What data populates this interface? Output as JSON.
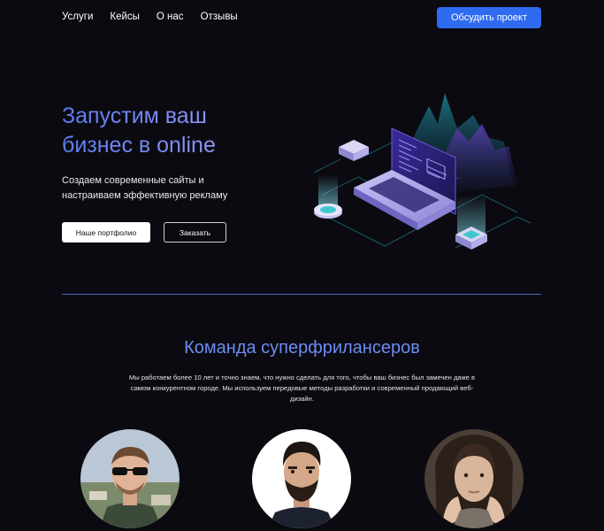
{
  "nav": {
    "links": [
      "Услуги",
      "Кейсы",
      "О нас",
      "Отзывы"
    ],
    "cta": "Обсудить проект"
  },
  "hero": {
    "title_line1": "Запустим ваш",
    "title_line2": "бизнес в online",
    "subtitle": "Создаем современные сайты и настраиваем эффективную рекламу",
    "btn_portfolio": "Наше портфолио",
    "btn_order": "Заказать"
  },
  "team": {
    "title": "Команда суперфрилансеров",
    "description": "Мы работаем более 10 лет и точно знаем, что нужно сделать для того, чтобы ваш бизнес был замечен даже в самом конкурентном городе. Мы используем передовые методы разработки и современный продающий веб-дизайн."
  },
  "colors": {
    "accent": "#2f6bf0",
    "background": "#0b0a10",
    "heading_gradient_start": "#5b7cf4",
    "heading_gradient_end": "#b7b3f5"
  },
  "icons": [
    "isometric-laptop-illustration",
    "avatar-photo-1",
    "avatar-photo-2",
    "avatar-photo-3"
  ]
}
